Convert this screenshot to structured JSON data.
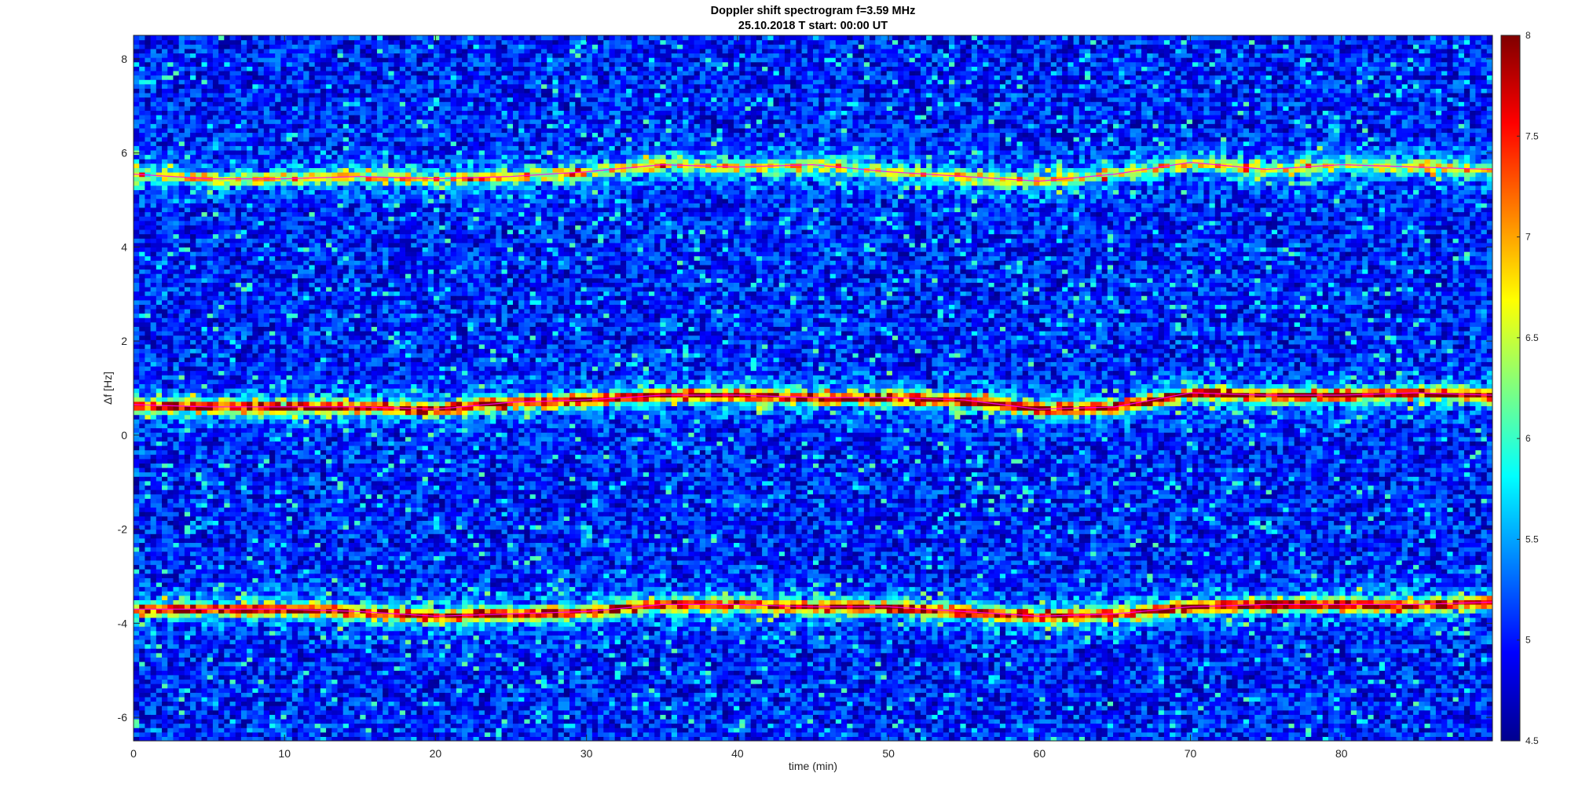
{
  "chart_data": {
    "type": "heatmap",
    "title": "Doppler shift spectrogram f=3.59 MHz",
    "subtitle": "25.10.2018   T start: 00:00 UT",
    "xlabel": "time (min)",
    "ylabel": "Δf [Hz]",
    "xlim": [
      0,
      90
    ],
    "ylim": [
      -6.5,
      8.5
    ],
    "xticks": [
      0,
      10,
      20,
      30,
      40,
      50,
      60,
      70,
      80
    ],
    "yticks": [
      -6,
      -4,
      -2,
      0,
      2,
      4,
      6,
      8
    ],
    "colorbar": {
      "colormap": "jet",
      "clim": [
        4.5,
        8
      ],
      "ticks": [
        4.5,
        5,
        5.5,
        6,
        6.5,
        7,
        7.5,
        8
      ]
    },
    "grid": false,
    "background_level": 5.0,
    "trace_color": "#ff00ff",
    "series": [
      {
        "x": [
          0,
          5,
          10,
          15,
          20,
          25,
          30,
          35,
          40,
          45,
          50,
          55,
          60,
          65,
          70,
          75,
          80,
          85,
          90
        ],
        "y": [
          5.55,
          5.45,
          5.45,
          5.5,
          5.45,
          5.5,
          5.6,
          5.75,
          5.7,
          5.75,
          5.6,
          5.5,
          5.4,
          5.55,
          5.8,
          5.65,
          5.75,
          5.7,
          5.65
        ],
        "intensity": 6.3
      },
      {
        "x": [
          0,
          5,
          10,
          15,
          20,
          25,
          30,
          35,
          40,
          45,
          50,
          55,
          60,
          65,
          70,
          75,
          80,
          85,
          90
        ],
        "y": [
          0.65,
          0.6,
          0.6,
          0.6,
          0.55,
          0.7,
          0.75,
          0.85,
          0.85,
          0.8,
          0.8,
          0.75,
          0.55,
          0.6,
          0.9,
          0.85,
          0.85,
          0.9,
          0.85
        ],
        "intensity": 7.6
      },
      {
        "x": [
          0,
          5,
          10,
          15,
          20,
          25,
          30,
          35,
          40,
          45,
          50,
          55,
          60,
          65,
          70,
          75,
          80,
          85,
          90
        ],
        "y": [
          -3.7,
          -3.7,
          -3.7,
          -3.75,
          -3.85,
          -3.8,
          -3.75,
          -3.6,
          -3.6,
          -3.65,
          -3.65,
          -3.75,
          -3.85,
          -3.8,
          -3.65,
          -3.6,
          -3.6,
          -3.6,
          -3.55
        ],
        "intensity": 7.5
      }
    ]
  }
}
